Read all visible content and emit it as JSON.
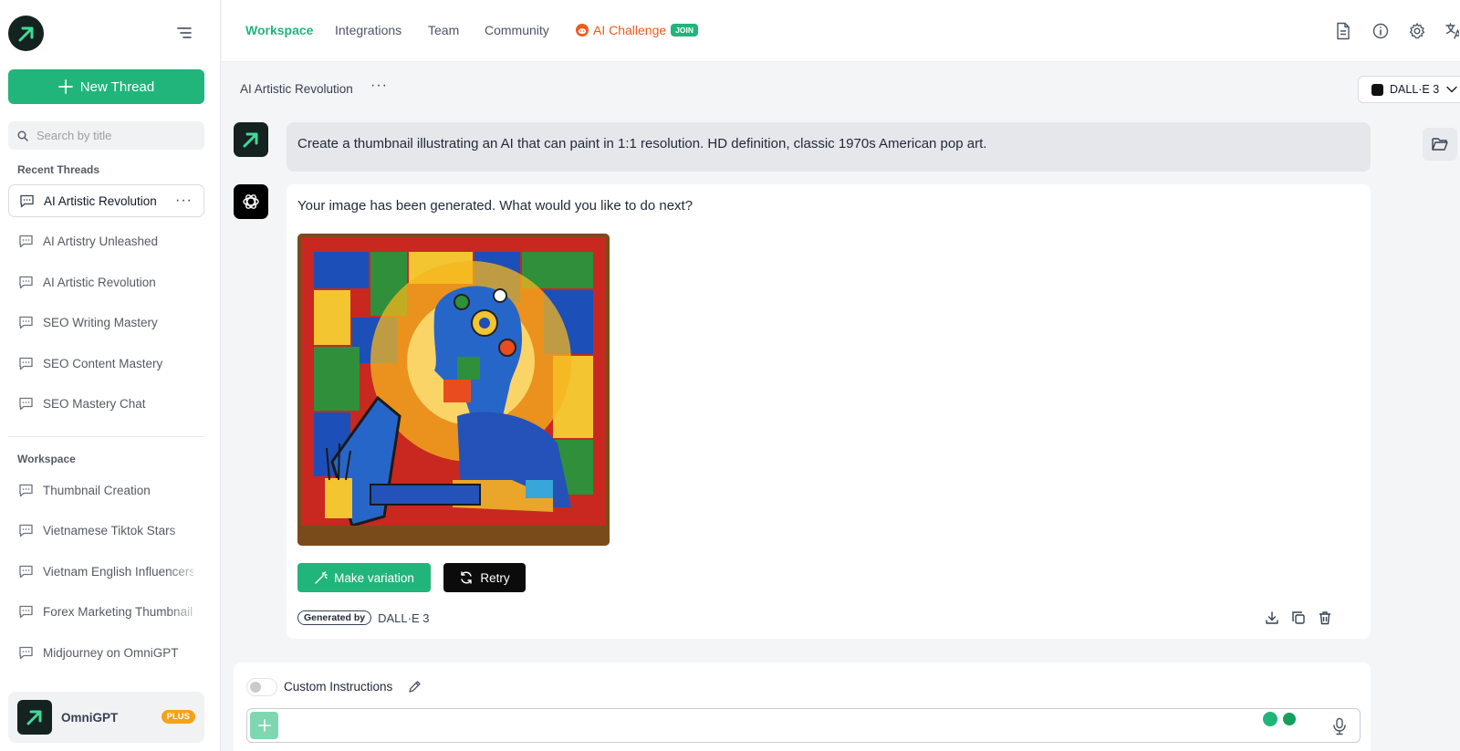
{
  "app": {
    "name": "OmniGPT",
    "plan_badge": "PLUS"
  },
  "sidebar": {
    "new_thread_label": "New Thread",
    "search_placeholder": "Search by title",
    "recent_title": "Recent Threads",
    "recent_threads": [
      {
        "label": "AI Artistic Revolution"
      },
      {
        "label": "AI Artistry Unleashed"
      },
      {
        "label": "AI Artistic Revolution"
      },
      {
        "label": "SEO Writing Mastery"
      },
      {
        "label": "SEO Content Mastery"
      },
      {
        "label": "SEO Mastery Chat"
      }
    ],
    "workspace_title": "Workspace",
    "workspace_threads": [
      {
        "label": "Thumbnail Creation"
      },
      {
        "label": "Vietnamese Tiktok Stars"
      },
      {
        "label": "Vietnam English Influencers"
      },
      {
        "label": "Forex Marketing Thumbnail"
      },
      {
        "label": "Midjourney on OmniGPT"
      }
    ]
  },
  "topnav": {
    "links": [
      {
        "label": "Workspace"
      },
      {
        "label": "Integrations"
      },
      {
        "label": "Team"
      },
      {
        "label": "Community"
      }
    ],
    "challenge_label": "AI Challenge",
    "challenge_badge": "JOIN",
    "icons": [
      "document-icon",
      "info-icon",
      "settings-gear-icon",
      "translate-icon"
    ]
  },
  "thread": {
    "title": "AI Artistic Revolution",
    "more": "···",
    "model": "DALL·E 3"
  },
  "messages": {
    "user_text": "Create a thumbnail illustrating an AI that can paint in 1:1 resolution. HD definition, classic 1970s American pop art.",
    "assistant_text": "Your image has been generated. What would you like to do next?",
    "variation_label": "Make variation",
    "retry_label": "Retry",
    "generated_by_badge": "Generated by",
    "generated_by_model": "DALL·E 3"
  },
  "composer": {
    "custom_instructions_label": "Custom Instructions",
    "prompt_value": "",
    "prompt_placeholder": ""
  },
  "colors": {
    "brand_green": "#21b57b",
    "challenge_orange": "#f05a1c",
    "plus_badge": "#f3a21b",
    "dark_logo": "#142220"
  }
}
